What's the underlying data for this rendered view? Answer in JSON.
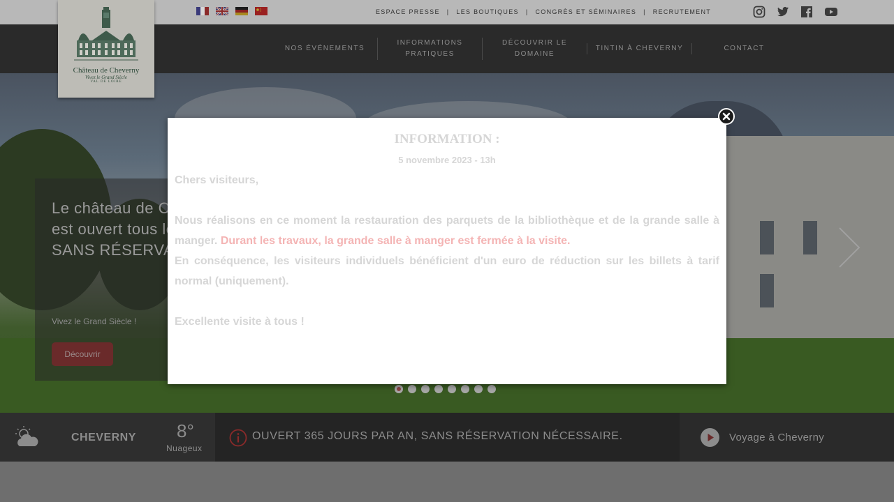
{
  "topbar": {
    "flags": [
      {
        "name": "fr"
      },
      {
        "name": "en"
      },
      {
        "name": "de"
      },
      {
        "name": "cn"
      }
    ],
    "links": [
      "ESPACE PRESSE",
      "LES BOUTIQUES",
      "CONGRÈS ET SÉMINAIRES",
      "RECRUTEMENT"
    ],
    "separator": "|",
    "social": [
      "instagram-icon",
      "twitter-icon",
      "facebook-icon",
      "youtube-icon"
    ]
  },
  "logo": {
    "title": "Château de Cheverny",
    "subtitle": "Vivez le Grand Siècle",
    "region": "VAL DE LOIRE"
  },
  "nav": {
    "items": [
      "NOS ÉVÉNEMENTS",
      "INFORMATIONS PRATIQUES",
      "DÉCOUVRIR LE DOMAINE",
      "TINTIN À CHEVERNY",
      "CONTACT"
    ]
  },
  "hero": {
    "title": "Le château de Cheverny est ouvert tous les jours, SANS RÉSERVATION",
    "subtitle": "Vivez le Grand Siècle !",
    "button": "Découvrir",
    "slides": 8,
    "active_slide": 0
  },
  "modal": {
    "title": "INFORMATION :",
    "date": "5 novembre 2023 - 13h",
    "greeting": "Chers visiteurs,",
    "p1_start": "Nous réalisons en ce moment la restauration des parquets de la bibliothèque et de la grande salle à manger.",
    "p1_highlight": "Durant les travaux, la grande salle à manger est fermée à la visite.",
    "p2": "En conséquence, les visiteurs individuels bénéficient d'un euro de réduction sur les billets à tarif normal (uniquement).",
    "closing": "Excellente visite à tous !"
  },
  "weather": {
    "city": "CHEVERNY",
    "temperature": "8°",
    "condition": "Nuageux"
  },
  "notice": {
    "text": "OUVERT 365 JOURS PAR AN, SANS RÉSERVATION NÉCESSAIRE."
  },
  "voyage": {
    "label": "Voyage à Cheverny"
  },
  "colors": {
    "nav_bg": "#2a2a2a",
    "accent_red": "#8a2a2a",
    "highlight_red": "#f4b4b4"
  }
}
